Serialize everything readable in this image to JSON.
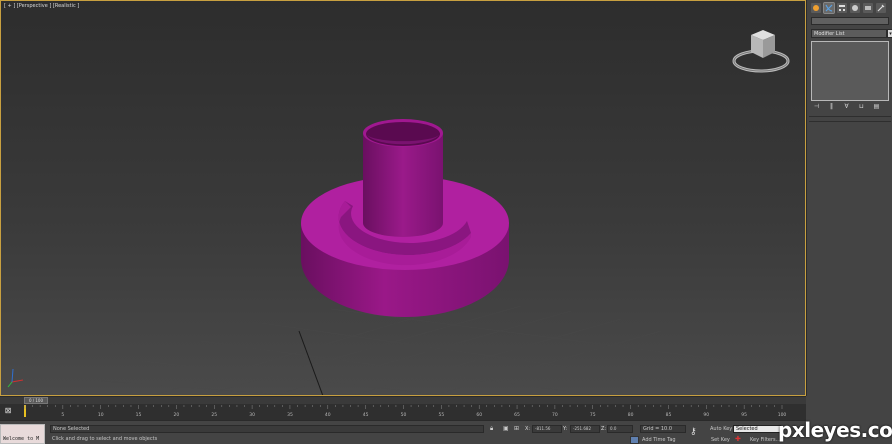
{
  "viewport": {
    "label": "[ + ] [Perspective ] [Realistic ]",
    "colors": {
      "border": "#c8a040",
      "model": "#a0188f"
    }
  },
  "command_panel": {
    "tabs": [
      "create-icon",
      "modify-icon",
      "hierarchy-icon",
      "motion-icon",
      "display-icon",
      "utilities-icon"
    ],
    "name_value": "",
    "modifier_list": "Modifier List"
  },
  "timeline": {
    "slider_label": "0 / 100",
    "ticks": [
      "0",
      "5",
      "10",
      "15",
      "20",
      "25",
      "30",
      "35",
      "40",
      "45",
      "50",
      "55",
      "60",
      "65",
      "70",
      "75",
      "80",
      "85",
      "90",
      "95",
      "100"
    ]
  },
  "status": {
    "maxscript": "Welcome to M",
    "selection": "None Selected",
    "prompt": "Click and drag to select and move objects",
    "x_label": "X:",
    "x_value": "-811.56",
    "y_label": "Y:",
    "y_value": "-251.682",
    "z_label": "Z:",
    "z_value": "0.0",
    "grid": "Grid = 10.0",
    "add_time_tag": "Add Time Tag",
    "auto_key": "Auto Key",
    "set_key": "Set Key",
    "selected": "Selected",
    "key_filters": "Key Filters..."
  },
  "watermark": "pxleyes.com"
}
